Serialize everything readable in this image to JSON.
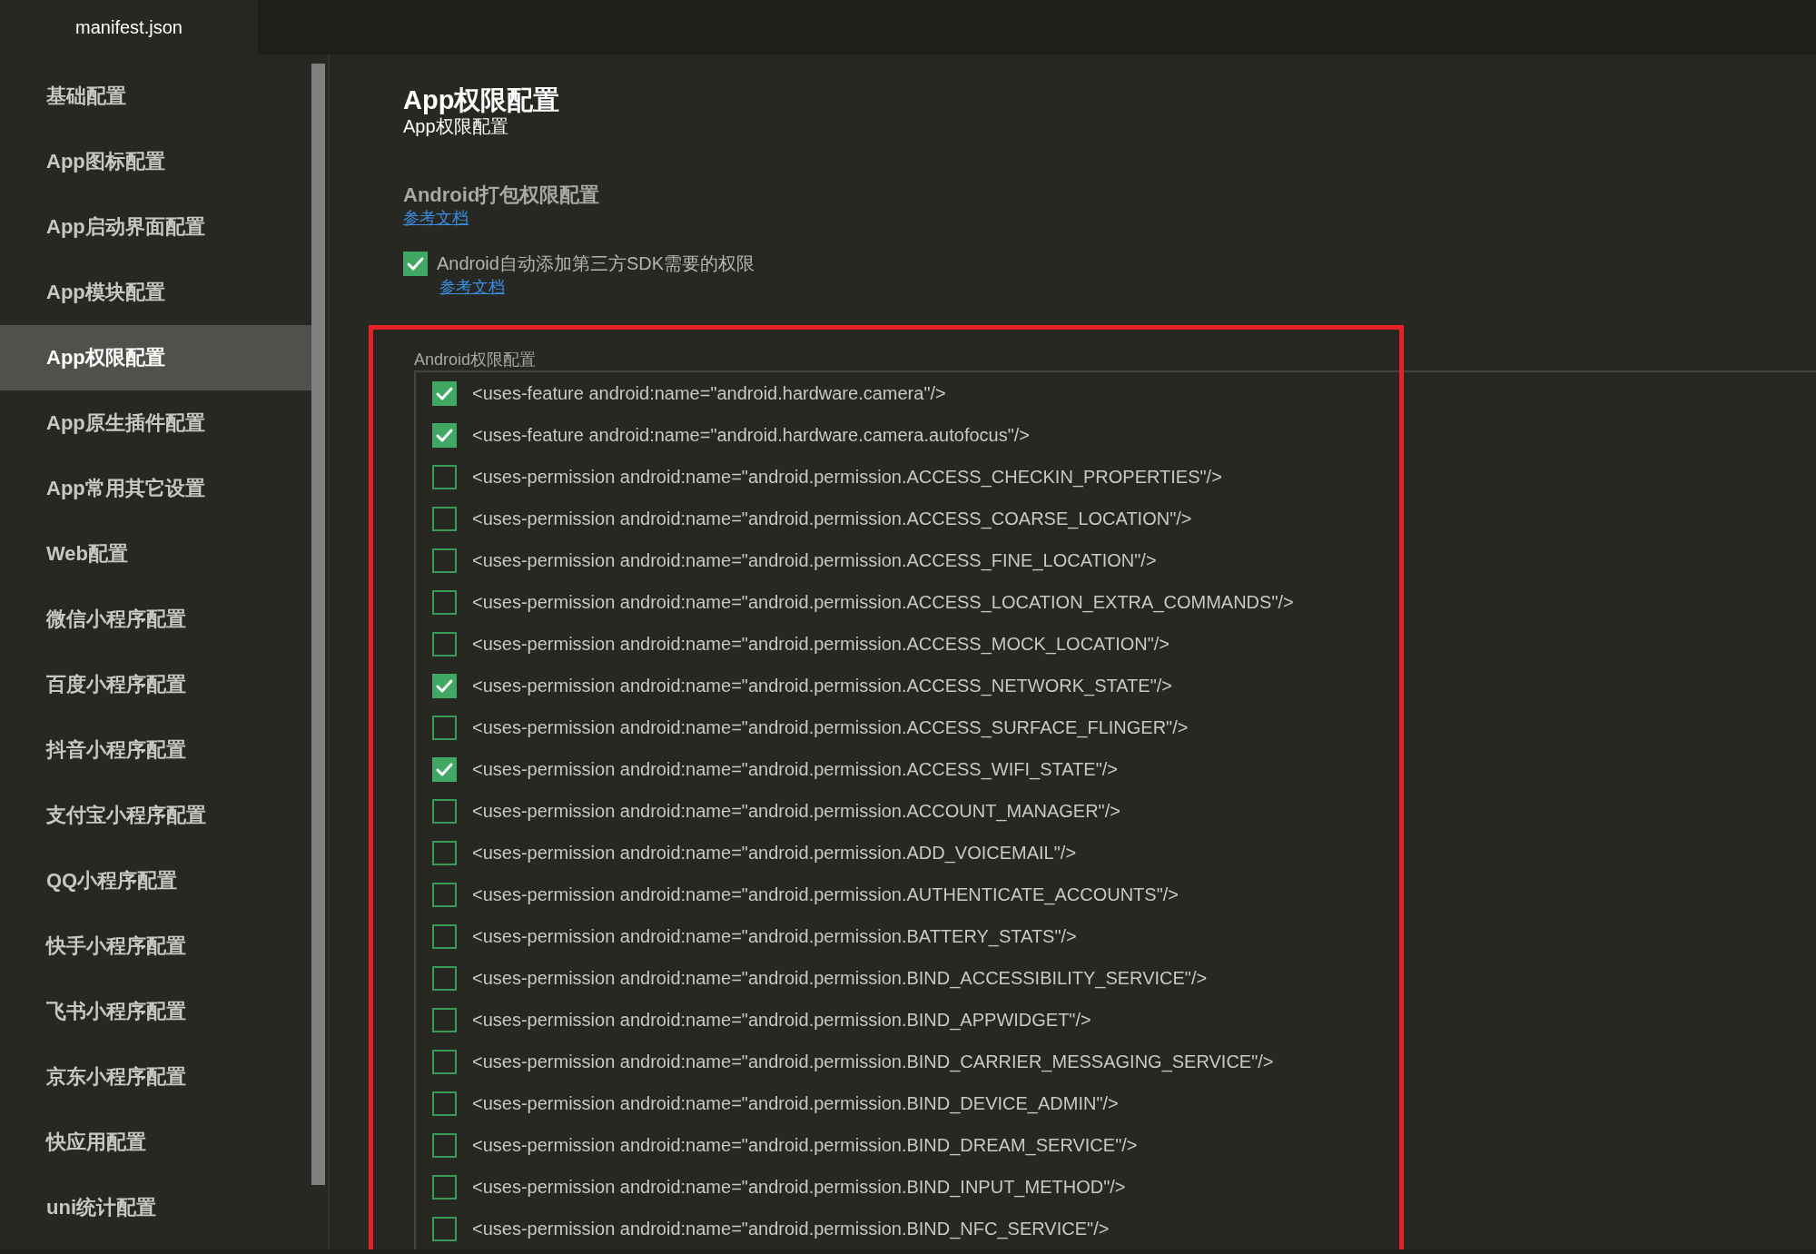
{
  "tabs": [
    {
      "label": "manifest.json",
      "selected": true
    }
  ],
  "sidebar": {
    "items": [
      {
        "label": "基础配置",
        "selected": false
      },
      {
        "label": "App图标配置",
        "selected": false
      },
      {
        "label": "App启动界面配置",
        "selected": false
      },
      {
        "label": "App模块配置",
        "selected": false
      },
      {
        "label": "App权限配置",
        "selected": true
      },
      {
        "label": "App原生插件配置",
        "selected": false
      },
      {
        "label": "App常用其它设置",
        "selected": false
      },
      {
        "label": "Web配置",
        "selected": false
      },
      {
        "label": "微信小程序配置",
        "selected": false
      },
      {
        "label": "百度小程序配置",
        "selected": false
      },
      {
        "label": "抖音小程序配置",
        "selected": false
      },
      {
        "label": "支付宝小程序配置",
        "selected": false
      },
      {
        "label": "QQ小程序配置",
        "selected": false
      },
      {
        "label": "快手小程序配置",
        "selected": false
      },
      {
        "label": "飞书小程序配置",
        "selected": false
      },
      {
        "label": "京东小程序配置",
        "selected": false
      },
      {
        "label": "快应用配置",
        "selected": false
      },
      {
        "label": "uni统计配置",
        "selected": false
      }
    ]
  },
  "page": {
    "title": "App权限配置",
    "subtitle": "App权限配置"
  },
  "android_package": {
    "heading": "Android打包权限配置",
    "link": "参考文档",
    "auto_add": {
      "label": "Android自动添加第三方SDK需要的权限",
      "checked": true,
      "link": "参考文档"
    }
  },
  "permissions": {
    "legend": "Android权限配置",
    "highlighted": true,
    "items": [
      {
        "text": "<uses-feature android:name=\"android.hardware.camera\"/>",
        "checked": true
      },
      {
        "text": "<uses-feature android:name=\"android.hardware.camera.autofocus\"/>",
        "checked": true
      },
      {
        "text": "<uses-permission android:name=\"android.permission.ACCESS_CHECKIN_PROPERTIES\"/>",
        "checked": false
      },
      {
        "text": "<uses-permission android:name=\"android.permission.ACCESS_COARSE_LOCATION\"/>",
        "checked": false
      },
      {
        "text": "<uses-permission android:name=\"android.permission.ACCESS_FINE_LOCATION\"/>",
        "checked": false
      },
      {
        "text": "<uses-permission android:name=\"android.permission.ACCESS_LOCATION_EXTRA_COMMANDS\"/>",
        "checked": false
      },
      {
        "text": "<uses-permission android:name=\"android.permission.ACCESS_MOCK_LOCATION\"/>",
        "checked": false
      },
      {
        "text": "<uses-permission android:name=\"android.permission.ACCESS_NETWORK_STATE\"/>",
        "checked": true
      },
      {
        "text": "<uses-permission android:name=\"android.permission.ACCESS_SURFACE_FLINGER\"/>",
        "checked": false
      },
      {
        "text": "<uses-permission android:name=\"android.permission.ACCESS_WIFI_STATE\"/>",
        "checked": true
      },
      {
        "text": "<uses-permission android:name=\"android.permission.ACCOUNT_MANAGER\"/>",
        "checked": false
      },
      {
        "text": "<uses-permission android:name=\"android.permission.ADD_VOICEMAIL\"/>",
        "checked": false
      },
      {
        "text": "<uses-permission android:name=\"android.permission.AUTHENTICATE_ACCOUNTS\"/>",
        "checked": false
      },
      {
        "text": "<uses-permission android:name=\"android.permission.BATTERY_STATS\"/>",
        "checked": false
      },
      {
        "text": "<uses-permission android:name=\"android.permission.BIND_ACCESSIBILITY_SERVICE\"/>",
        "checked": false
      },
      {
        "text": "<uses-permission android:name=\"android.permission.BIND_APPWIDGET\"/>",
        "checked": false
      },
      {
        "text": "<uses-permission android:name=\"android.permission.BIND_CARRIER_MESSAGING_SERVICE\"/>",
        "checked": false
      },
      {
        "text": "<uses-permission android:name=\"android.permission.BIND_DEVICE_ADMIN\"/>",
        "checked": false
      },
      {
        "text": "<uses-permission android:name=\"android.permission.BIND_DREAM_SERVICE\"/>",
        "checked": false
      },
      {
        "text": "<uses-permission android:name=\"android.permission.BIND_INPUT_METHOD\"/>",
        "checked": false
      },
      {
        "text": "<uses-permission android:name=\"android.permission.BIND_NFC_SERVICE\"/>",
        "checked": false
      }
    ]
  }
}
